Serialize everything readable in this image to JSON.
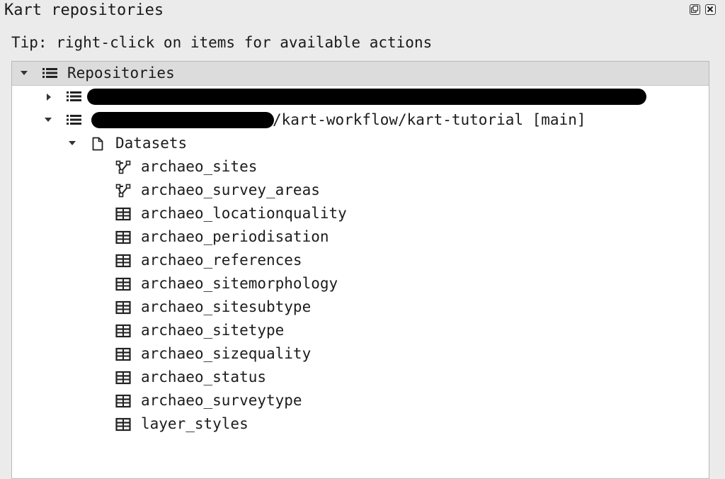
{
  "window": {
    "title": "Kart repositories",
    "float_icon": "float-window-icon",
    "close_icon": "close-window-icon"
  },
  "tip": "Tip: right-click on items for available actions",
  "tree": {
    "root": {
      "label": "Repositories",
      "expanded": true,
      "icon": "list-icon"
    },
    "repos": [
      {
        "label": "",
        "expanded": false,
        "icon": "list-icon",
        "redacted": true
      },
      {
        "label": "/kart-workflow/kart-tutorial [main]",
        "expanded": true,
        "icon": "list-icon",
        "redacted_prefix": true
      }
    ],
    "datasets_group": {
      "label": "Datasets",
      "expanded": true,
      "icon": "document-icon"
    },
    "datasets": [
      {
        "name": "archaeo_sites",
        "type": "vector",
        "icon": "vector-icon"
      },
      {
        "name": "archaeo_survey_areas",
        "type": "vector",
        "icon": "vector-icon"
      },
      {
        "name": "archaeo_locationquality",
        "type": "table",
        "icon": "table-icon"
      },
      {
        "name": "archaeo_periodisation",
        "type": "table",
        "icon": "table-icon"
      },
      {
        "name": "archaeo_references",
        "type": "table",
        "icon": "table-icon"
      },
      {
        "name": "archaeo_sitemorphology",
        "type": "table",
        "icon": "table-icon"
      },
      {
        "name": "archaeo_sitesubtype",
        "type": "table",
        "icon": "table-icon"
      },
      {
        "name": "archaeo_sitetype",
        "type": "table",
        "icon": "table-icon"
      },
      {
        "name": "archaeo_sizequality",
        "type": "table",
        "icon": "table-icon"
      },
      {
        "name": "archaeo_status",
        "type": "table",
        "icon": "table-icon"
      },
      {
        "name": "archaeo_surveytype",
        "type": "table",
        "icon": "table-icon"
      },
      {
        "name": "layer_styles",
        "type": "table",
        "icon": "table-icon"
      }
    ]
  }
}
